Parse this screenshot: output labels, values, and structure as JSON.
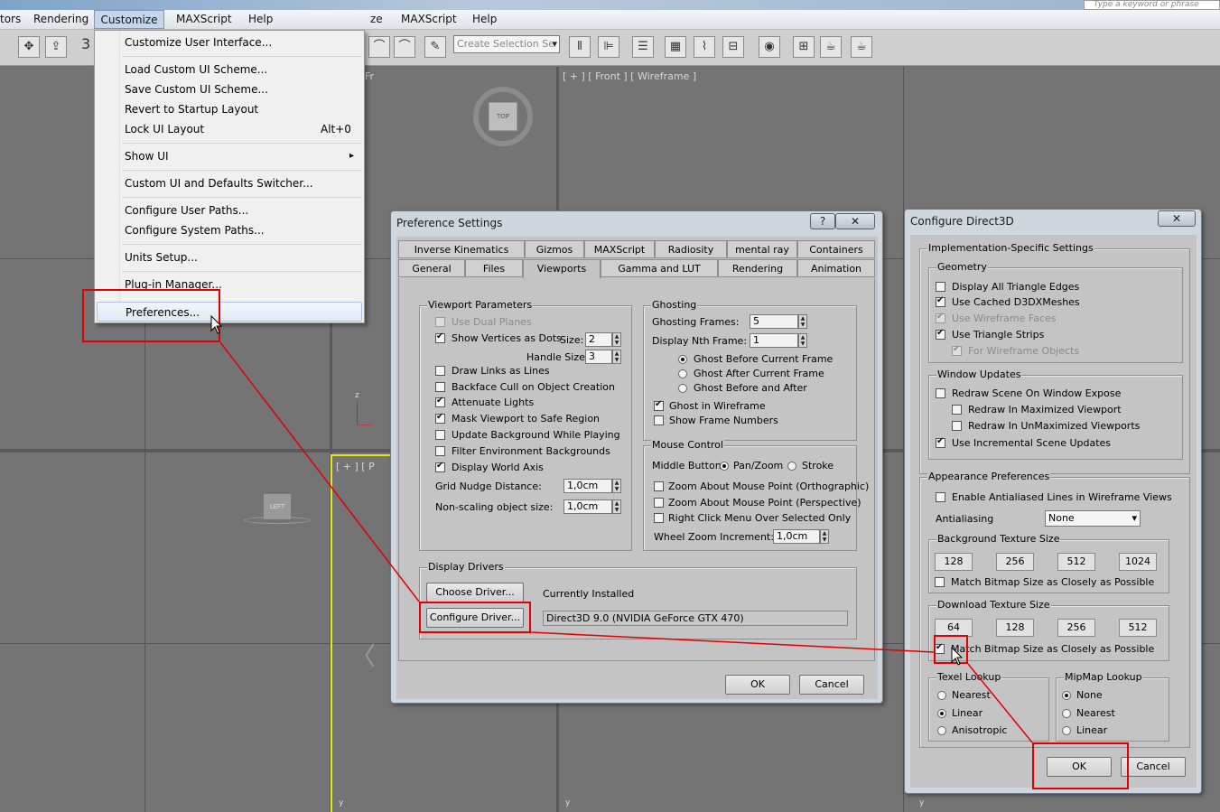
{
  "menubar": {
    "items": [
      "tors",
      "Rendering",
      "Customize",
      "MAXScript",
      "Help",
      "ze",
      "MAXScript",
      "Help"
    ],
    "search_placeholder": "Type a keyword or phrase"
  },
  "toolbar": {
    "number": "3",
    "selection_set_placeholder": "Create Selection Se"
  },
  "viewports": {
    "top_nav": "TOP",
    "front_label": "[ + ] [ Front ] [ Wireframe ]",
    "left_label": "[ + ] [ P",
    "left_nav": "LEFT",
    "fr_fragment": "Fr",
    "axis_z": "z",
    "axis_x": "x",
    "axis_y": "y"
  },
  "customize_menu": {
    "items": [
      {
        "label": "Customize User Interface...",
        "shortcut": ""
      },
      {
        "label": "Load Custom UI Scheme...",
        "shortcut": ""
      },
      {
        "label": "Save Custom UI Scheme...",
        "shortcut": ""
      },
      {
        "label": "Revert to Startup Layout",
        "shortcut": ""
      },
      {
        "label": "Lock UI Layout",
        "shortcut": "Alt+0"
      },
      {
        "label": "Show UI",
        "shortcut": "▸"
      },
      {
        "label": "Custom UI and Defaults Switcher...",
        "shortcut": ""
      },
      {
        "label": "Configure User Paths...",
        "shortcut": ""
      },
      {
        "label": "Configure System Paths...",
        "shortcut": ""
      },
      {
        "label": "Units Setup...",
        "shortcut": ""
      },
      {
        "label": "Plug-in Manager...",
        "shortcut": ""
      },
      {
        "label": "Preferences...",
        "shortcut": ""
      }
    ]
  },
  "pref": {
    "title": "Preference Settings",
    "help": "?",
    "close": "✕",
    "tabs_row1": [
      "Inverse Kinematics",
      "Gizmos",
      "MAXScript",
      "Radiosity",
      "mental ray",
      "Containers"
    ],
    "tabs_row2": [
      "General",
      "Files",
      "Viewports",
      "Gamma and LUT",
      "Rendering",
      "Animation"
    ],
    "vp": {
      "title": "Viewport Parameters",
      "use_dual": "Use Dual Planes",
      "show_vertices": "Show Vertices as Dots",
      "size_label": "Size:",
      "size_val": "2",
      "handle_label": "Handle Size:",
      "handle_val": "3",
      "draw_links": "Draw Links as Lines",
      "backface": "Backface Cull on Object Creation",
      "attenuate": "Attenuate Lights",
      "mask": "Mask Viewport to Safe Region",
      "update_bg": "Update Background While Playing",
      "filter_env": "Filter Environment Backgrounds",
      "world_axis": "Display World Axis",
      "grid_nudge": "Grid Nudge Distance:",
      "grid_nudge_val": "1,0cm",
      "nonscaling": "Non-scaling object size:",
      "nonscaling_val": "1,0cm"
    },
    "gh": {
      "title": "Ghosting",
      "frames": "Ghosting Frames:",
      "frames_val": "5",
      "nth": "Display Nth Frame:",
      "nth_val": "1",
      "before": "Ghost Before Current Frame",
      "after": "Ghost After Current Frame",
      "both": "Ghost Before and After",
      "wire": "Ghost in Wireframe",
      "numbers": "Show Frame Numbers"
    },
    "mc": {
      "title": "Mouse Control",
      "middle": "Middle Button:",
      "panzoom": "Pan/Zoom",
      "stroke": "Stroke",
      "zoom_ortho": "Zoom About Mouse Point (Orthographic)",
      "zoom_persp": "Zoom About Mouse Point (Perspective)",
      "right_click": "Right Click Menu Over Selected Only",
      "wheel": "Wheel Zoom Increment:",
      "wheel_val": "1,0cm"
    },
    "dd": {
      "title": "Display Drivers",
      "choose": "Choose Driver...",
      "configure": "Configure Driver...",
      "installed": "Currently Installed",
      "driver": "Direct3D 9.0 (NVIDIA GeForce GTX 470)"
    },
    "ok": "OK",
    "cancel": "Cancel"
  },
  "d3d": {
    "title": "Configure Direct3D",
    "close": "✕",
    "impl": "Implementation-Specific Settings",
    "geometry": "Geometry",
    "g_all_edges": "Display All Triangle Edges",
    "g_cached": "Use Cached D3DXMeshes",
    "g_wire_faces": "Use Wireframe Faces",
    "g_strips": "Use Triangle Strips",
    "g_wire_objects": "For Wireframe Objects",
    "window_updates": "Window Updates",
    "w_redraw": "Redraw Scene On Window Expose",
    "w_max": "Redraw In Maximized Viewport",
    "w_unmax": "Redraw In UnMaximized Viewports",
    "w_incremental": "Use Incremental Scene Updates",
    "appearance": "Appearance Preferences",
    "antialiased": "Enable Antialiased Lines in Wireframe Views",
    "aa_label": "Antialiasing",
    "aa_val": "None",
    "bg_size": "Background Texture Size",
    "bg_sizes": [
      "128",
      "256",
      "512",
      "1024"
    ],
    "bg_match": "Match Bitmap Size as Closely as Possible",
    "dl_size": "Download Texture Size",
    "dl_sizes": [
      "64",
      "128",
      "256",
      "512"
    ],
    "dl_match": "Match Bitmap Size as Closely as Possible",
    "texel": "Texel Lookup",
    "texel_opts": [
      "Nearest",
      "Linear",
      "Anisotropic"
    ],
    "mipmap": "MipMap Lookup",
    "mipmap_opts": [
      "None",
      "Nearest",
      "Linear"
    ],
    "ok": "OK",
    "cancel": "Cancel"
  }
}
